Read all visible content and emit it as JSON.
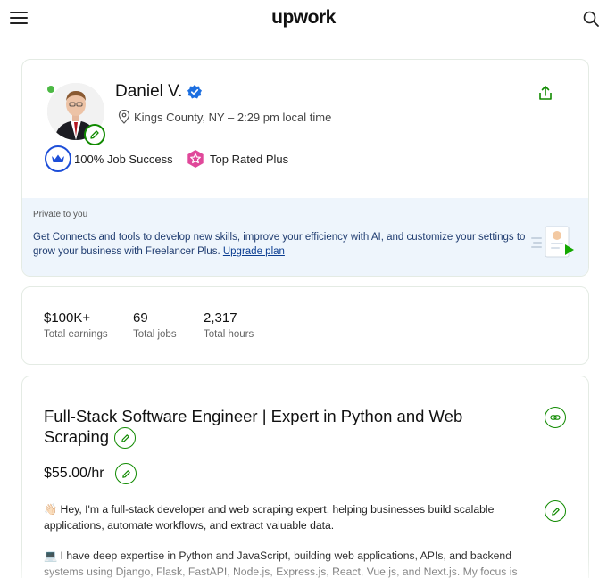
{
  "header": {
    "logo_text": "upwork",
    "menu_icon": "hamburger-menu-icon",
    "search_icon": "search-icon"
  },
  "profile": {
    "name": "Daniel V.",
    "verified_icon": "verified-badge-icon",
    "location": "Kings County, NY – 2:29 pm local time",
    "online": true,
    "job_success": "100% Job Success",
    "top_rated": "Top Rated Plus",
    "share_icon": "share-icon",
    "private_label": "Private to you",
    "private_message": "Get Connects and tools to develop new skills, improve your efficiency with AI, and customize your settings to grow your business with Freelancer Plus.",
    "upgrade_link": "Upgrade plan"
  },
  "stats": [
    {
      "value": "$100K+",
      "label": "Total earnings"
    },
    {
      "value": "69",
      "label": "Total jobs"
    },
    {
      "value": "2,317",
      "label": "Total hours"
    }
  ],
  "main": {
    "title": "Full-Stack Software Engineer | Expert in Python and Web Scraping",
    "rate": "$55.00/hr",
    "paragraph_1": "👋🏻 Hey, I'm a full-stack developer and web scraping expert, helping businesses build scalable applications, automate workflows, and extract valuable data.",
    "paragraph_2": "💻 I have deep expertise in Python and JavaScript, building web applications, APIs, and backend systems using Django, Flask, FastAPI, Node.js, Express.js, React, Vue.js, and Next.js. My focus is on"
  },
  "colors": {
    "brand_green": "#108a00",
    "online_green": "#4cb944",
    "verified_blue": "#1d6fe0",
    "private_bg": "#eef5fc",
    "top_rated_pink": "#e0489a"
  }
}
